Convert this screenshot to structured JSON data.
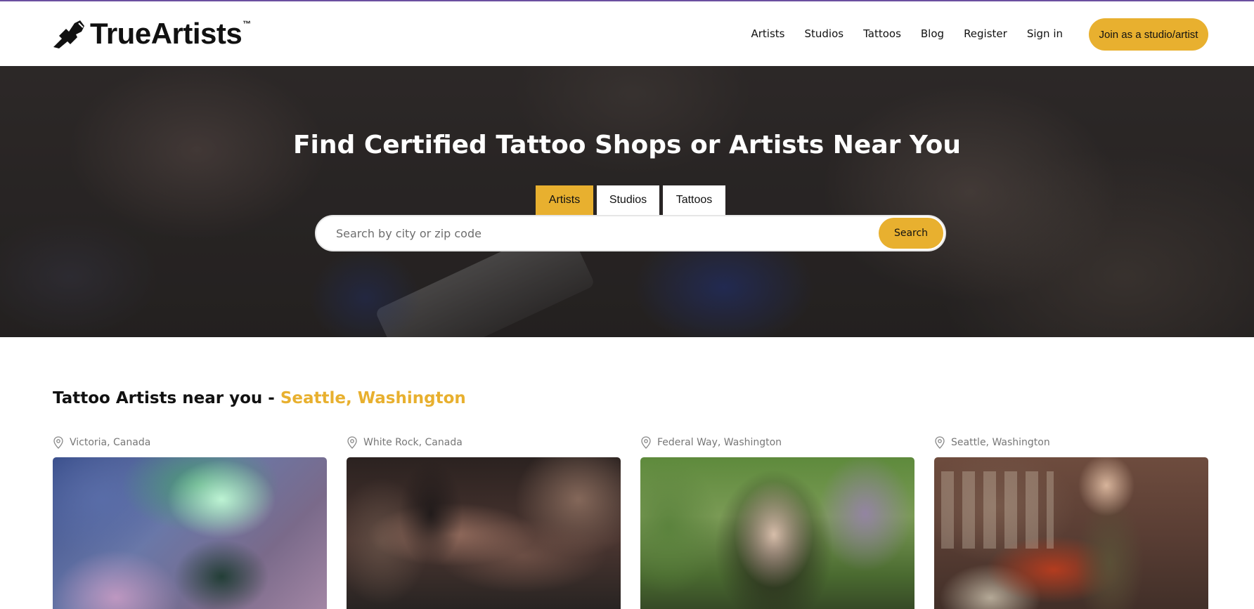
{
  "logo": {
    "name": "TrueArtists",
    "trademark": "™",
    "icon": "tattoo-machine-icon"
  },
  "nav": {
    "items": [
      {
        "label": "Artists"
      },
      {
        "label": "Studios"
      },
      {
        "label": "Tattoos"
      },
      {
        "label": "Blog"
      },
      {
        "label": "Register"
      },
      {
        "label": "Sign in"
      }
    ],
    "cta_label": "Join as a studio/artist"
  },
  "hero": {
    "title": "Find Certified Tattoo Shops or Artists Near You",
    "tabs": [
      {
        "label": "Artists",
        "active": true
      },
      {
        "label": "Studios",
        "active": false
      },
      {
        "label": "Tattoos",
        "active": false
      }
    ],
    "search": {
      "placeholder": "Search by city or zip code",
      "value": "",
      "button_label": "Search"
    }
  },
  "section": {
    "title_prefix": "Tattoo Artists near you - ",
    "title_location": "Seattle, Washington"
  },
  "cards": [
    {
      "location": "Victoria, Canada",
      "icon": "map-pin-icon"
    },
    {
      "location": "White Rock, Canada",
      "icon": "map-pin-icon"
    },
    {
      "location": "Federal Way, Washington",
      "icon": "map-pin-icon"
    },
    {
      "location": "Seattle, Washington",
      "icon": "map-pin-icon"
    }
  ],
  "colors": {
    "accent": "#e8b02f",
    "text": "#111111",
    "muted": "#777777",
    "topline": "#6b4fa0"
  }
}
